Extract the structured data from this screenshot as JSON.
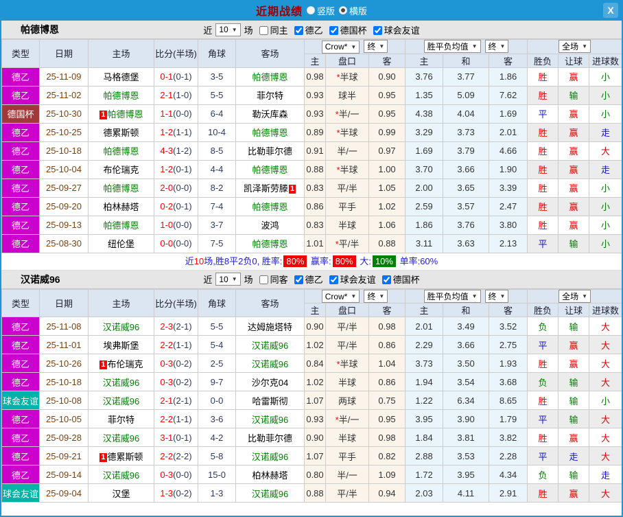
{
  "titlebar": {
    "title": "近期战绩",
    "vertical_label": "竖版",
    "horizontal_label": "横版",
    "vertical_checked": false,
    "horizontal_checked": true,
    "close_label": "X"
  },
  "league_colors": {
    "德乙": "#cc00cc",
    "德国杯": "#a03a3a",
    "球会友谊": "#00b3a6"
  },
  "result_colors": {
    "胜": "#e60000",
    "平": "#1414cc",
    "负": "#008000",
    "赢": "#e60000",
    "输": "#008000",
    "走": "#1414cc",
    "大": "#e60000",
    "小": "#008000"
  },
  "table_header": {
    "static_cols": [
      "类型",
      "日期",
      "主场",
      "比分(半场)",
      "角球",
      "客场"
    ],
    "odds_select": "Crow*",
    "odds_final_select": "终",
    "odds_sub": [
      "主",
      "盘口",
      "客"
    ],
    "avg_select": "胜平负均值",
    "avg_final_select": "终",
    "avg_sub": [
      "主",
      "和",
      "客"
    ],
    "result_select": "全场",
    "result_sub": [
      "胜负",
      "让球",
      "进球数"
    ]
  },
  "sections": [
    {
      "team": "帕德博恩",
      "filter": {
        "near": "近",
        "count": "10",
        "unit": "场",
        "checkboxes": [
          {
            "label": "同主",
            "checked": false
          },
          {
            "label": "德乙",
            "checked": true
          },
          {
            "label": "德国杯",
            "checked": true
          },
          {
            "label": "球会友谊",
            "checked": true
          }
        ]
      },
      "rows": [
        {
          "league": "德乙",
          "date": "25-11-09",
          "home": "马格德堡",
          "home_self": false,
          "home_badge": "",
          "score": "0-1",
          "half": "(0-1)",
          "corner": "3-5",
          "away": "帕德博恩",
          "away_self": true,
          "away_badge": "",
          "odds": [
            "0.98",
            "*半球",
            "0.90"
          ],
          "avg": [
            "3.76",
            "3.77",
            "1.86"
          ],
          "result": [
            "胜",
            "赢",
            "小"
          ]
        },
        {
          "league": "德乙",
          "date": "25-11-02",
          "home": "帕德博恩",
          "home_self": true,
          "home_badge": "",
          "score": "2-1",
          "half": "(1-0)",
          "corner": "5-5",
          "away": "菲尔特",
          "away_self": false,
          "away_badge": "",
          "odds": [
            "0.93",
            "球半",
            "0.95"
          ],
          "avg": [
            "1.35",
            "5.09",
            "7.62"
          ],
          "result": [
            "胜",
            "输",
            "小"
          ]
        },
        {
          "league": "德国杯",
          "date": "25-10-30",
          "home": "帕德博恩",
          "home_self": true,
          "home_badge": "1",
          "score": "1-1",
          "half": "(0-0)",
          "corner": "6-4",
          "away": "勒沃库森",
          "away_self": false,
          "away_badge": "",
          "odds": [
            "0.93",
            "*半/一",
            "0.95"
          ],
          "avg": [
            "4.38",
            "4.04",
            "1.69"
          ],
          "result": [
            "平",
            "赢",
            "小"
          ]
        },
        {
          "league": "德乙",
          "date": "25-10-25",
          "home": "德累斯顿",
          "home_self": false,
          "home_badge": "",
          "score": "1-2",
          "half": "(1-1)",
          "corner": "10-4",
          "away": "帕德博恩",
          "away_self": true,
          "away_badge": "",
          "odds": [
            "0.89",
            "*半球",
            "0.99"
          ],
          "avg": [
            "3.29",
            "3.73",
            "2.01"
          ],
          "result": [
            "胜",
            "赢",
            "走"
          ]
        },
        {
          "league": "德乙",
          "date": "25-10-18",
          "home": "帕德博恩",
          "home_self": true,
          "home_badge": "",
          "score": "4-3",
          "half": "(1-2)",
          "corner": "8-5",
          "away": "比勒菲尔德",
          "away_self": false,
          "away_badge": "",
          "odds": [
            "0.91",
            "半/一",
            "0.97"
          ],
          "avg": [
            "1.69",
            "3.79",
            "4.66"
          ],
          "result": [
            "胜",
            "赢",
            "大"
          ]
        },
        {
          "league": "德乙",
          "date": "25-10-04",
          "home": "布伦瑞克",
          "home_self": false,
          "home_badge": "",
          "score": "1-2",
          "half": "(0-1)",
          "corner": "4-4",
          "away": "帕德博恩",
          "away_self": true,
          "away_badge": "",
          "odds": [
            "0.88",
            "*半球",
            "1.00"
          ],
          "avg": [
            "3.70",
            "3.66",
            "1.90"
          ],
          "result": [
            "胜",
            "赢",
            "走"
          ]
        },
        {
          "league": "德乙",
          "date": "25-09-27",
          "home": "帕德博恩",
          "home_self": true,
          "home_badge": "",
          "score": "2-0",
          "half": "(0-0)",
          "corner": "8-2",
          "away": "凯泽斯劳滕",
          "away_self": false,
          "away_badge": "1",
          "odds": [
            "0.83",
            "平/半",
            "1.05"
          ],
          "avg": [
            "2.00",
            "3.65",
            "3.39"
          ],
          "result": [
            "胜",
            "赢",
            "小"
          ]
        },
        {
          "league": "德乙",
          "date": "25-09-20",
          "home": "柏林赫塔",
          "home_self": false,
          "home_badge": "",
          "score": "0-2",
          "half": "(0-1)",
          "corner": "7-4",
          "away": "帕德博恩",
          "away_self": true,
          "away_badge": "",
          "odds": [
            "0.86",
            "平手",
            "1.02"
          ],
          "avg": [
            "2.59",
            "3.57",
            "2.47"
          ],
          "result": [
            "胜",
            "赢",
            "小"
          ]
        },
        {
          "league": "德乙",
          "date": "25-09-13",
          "home": "帕德博恩",
          "home_self": true,
          "home_badge": "",
          "score": "1-0",
          "half": "(0-0)",
          "corner": "3-7",
          "away": "波鸿",
          "away_self": false,
          "away_badge": "",
          "odds": [
            "0.83",
            "半球",
            "1.06"
          ],
          "avg": [
            "1.86",
            "3.76",
            "3.80"
          ],
          "result": [
            "胜",
            "赢",
            "小"
          ]
        },
        {
          "league": "德乙",
          "date": "25-08-30",
          "home": "纽伦堡",
          "home_self": false,
          "home_badge": "",
          "score": "0-0",
          "half": "(0-0)",
          "corner": "7-5",
          "away": "帕德博恩",
          "away_self": true,
          "away_badge": "",
          "odds": [
            "1.01",
            "*平/半",
            "0.88"
          ],
          "avg": [
            "3.11",
            "3.63",
            "2.13"
          ],
          "result": [
            "平",
            "输",
            "小"
          ]
        }
      ],
      "summary": [
        {
          "t": "近",
          "c": "blue"
        },
        {
          "t": "10",
          "c": "red"
        },
        {
          "t": "场,胜8平2负0, 胜率:",
          "c": "blue"
        },
        {
          "t": "80%",
          "badge": "#f00000"
        },
        {
          "t": " 赢率:",
          "c": "blue"
        },
        {
          "t": "80%",
          "badge": "#f00000"
        },
        {
          "t": " 大:",
          "c": "blue"
        },
        {
          "t": "10%",
          "badge": "#008000"
        },
        {
          "t": " 单率:60%",
          "c": "blue"
        }
      ]
    },
    {
      "team": "汉诺威96",
      "filter": {
        "near": "近",
        "count": "10",
        "unit": "场",
        "checkboxes": [
          {
            "label": "同客",
            "checked": false
          },
          {
            "label": "德乙",
            "checked": true
          },
          {
            "label": "球会友谊",
            "checked": true
          },
          {
            "label": "德国杯",
            "checked": true
          }
        ]
      },
      "rows": [
        {
          "league": "德乙",
          "date": "25-11-08",
          "home": "汉诺威96",
          "home_self": true,
          "home_badge": "",
          "score": "2-3",
          "half": "(2-1)",
          "corner": "5-5",
          "away": "达姆施塔特",
          "away_self": false,
          "away_badge": "",
          "odds": [
            "0.90",
            "平/半",
            "0.98"
          ],
          "avg": [
            "2.01",
            "3.49",
            "3.52"
          ],
          "result": [
            "负",
            "输",
            "大"
          ]
        },
        {
          "league": "德乙",
          "date": "25-11-01",
          "home": "埃弗斯堡",
          "home_self": false,
          "home_badge": "",
          "score": "2-2",
          "half": "(1-1)",
          "corner": "5-4",
          "away": "汉诺威96",
          "away_self": true,
          "away_badge": "",
          "odds": [
            "1.02",
            "平/半",
            "0.86"
          ],
          "avg": [
            "2.29",
            "3.66",
            "2.75"
          ],
          "result": [
            "平",
            "赢",
            "大"
          ]
        },
        {
          "league": "德乙",
          "date": "25-10-26",
          "home": "布伦瑞克",
          "home_self": false,
          "home_badge": "1",
          "score": "0-3",
          "half": "(0-2)",
          "corner": "2-5",
          "away": "汉诺威96",
          "away_self": true,
          "away_badge": "",
          "odds": [
            "0.84",
            "*半球",
            "1.04"
          ],
          "avg": [
            "3.73",
            "3.50",
            "1.93"
          ],
          "result": [
            "胜",
            "赢",
            "大"
          ]
        },
        {
          "league": "德乙",
          "date": "25-10-18",
          "home": "汉诺威96",
          "home_self": true,
          "home_badge": "",
          "score": "0-3",
          "half": "(0-2)",
          "corner": "9-7",
          "away": "沙尔克04",
          "away_self": false,
          "away_badge": "",
          "odds": [
            "1.02",
            "半球",
            "0.86"
          ],
          "avg": [
            "1.94",
            "3.54",
            "3.68"
          ],
          "result": [
            "负",
            "输",
            "大"
          ]
        },
        {
          "league": "球会友谊",
          "date": "25-10-08",
          "home": "汉诺威96",
          "home_self": true,
          "home_badge": "",
          "score": "2-1",
          "half": "(2-1)",
          "corner": "0-0",
          "away": "哈雷斯彻",
          "away_self": false,
          "away_badge": "",
          "odds": [
            "1.07",
            "两球",
            "0.75"
          ],
          "avg": [
            "1.22",
            "6.34",
            "8.65"
          ],
          "result": [
            "胜",
            "输",
            "小"
          ]
        },
        {
          "league": "德乙",
          "date": "25-10-05",
          "home": "菲尔特",
          "home_self": false,
          "home_badge": "",
          "score": "2-2",
          "half": "(1-1)",
          "corner": "3-6",
          "away": "汉诺威96",
          "away_self": true,
          "away_badge": "",
          "odds": [
            "0.93",
            "*半/一",
            "0.95"
          ],
          "avg": [
            "3.95",
            "3.90",
            "1.79"
          ],
          "result": [
            "平",
            "输",
            "大"
          ]
        },
        {
          "league": "德乙",
          "date": "25-09-28",
          "home": "汉诺威96",
          "home_self": true,
          "home_badge": "",
          "score": "3-1",
          "half": "(0-1)",
          "corner": "4-2",
          "away": "比勒菲尔德",
          "away_self": false,
          "away_badge": "",
          "odds": [
            "0.90",
            "半球",
            "0.98"
          ],
          "avg": [
            "1.84",
            "3.81",
            "3.82"
          ],
          "result": [
            "胜",
            "赢",
            "大"
          ]
        },
        {
          "league": "德乙",
          "date": "25-09-21",
          "home": "德累斯顿",
          "home_self": false,
          "home_badge": "1",
          "score": "2-2",
          "half": "(2-2)",
          "corner": "5-8",
          "away": "汉诺威96",
          "away_self": true,
          "away_badge": "",
          "odds": [
            "1.07",
            "平手",
            "0.82"
          ],
          "avg": [
            "2.88",
            "3.53",
            "2.28"
          ],
          "result": [
            "平",
            "走",
            "大"
          ]
        },
        {
          "league": "德乙",
          "date": "25-09-14",
          "home": "汉诺威96",
          "home_self": true,
          "home_badge": "",
          "score": "0-3",
          "half": "(0-0)",
          "corner": "15-0",
          "away": "柏林赫塔",
          "away_self": false,
          "away_badge": "",
          "odds": [
            "0.80",
            "半/一",
            "1.09"
          ],
          "avg": [
            "1.72",
            "3.95",
            "4.34"
          ],
          "result": [
            "负",
            "输",
            "走"
          ]
        },
        {
          "league": "球会友谊",
          "date": "25-09-04",
          "home": "汉堡",
          "home_self": false,
          "home_badge": "",
          "score": "1-3",
          "half": "(0-2)",
          "corner": "1-3",
          "away": "汉诺威96",
          "away_self": true,
          "away_badge": "",
          "odds": [
            "0.88",
            "平/半",
            "0.94"
          ],
          "avg": [
            "2.03",
            "4.11",
            "2.91"
          ],
          "result": [
            "胜",
            "赢",
            "大"
          ]
        }
      ],
      "summary": null
    }
  ]
}
